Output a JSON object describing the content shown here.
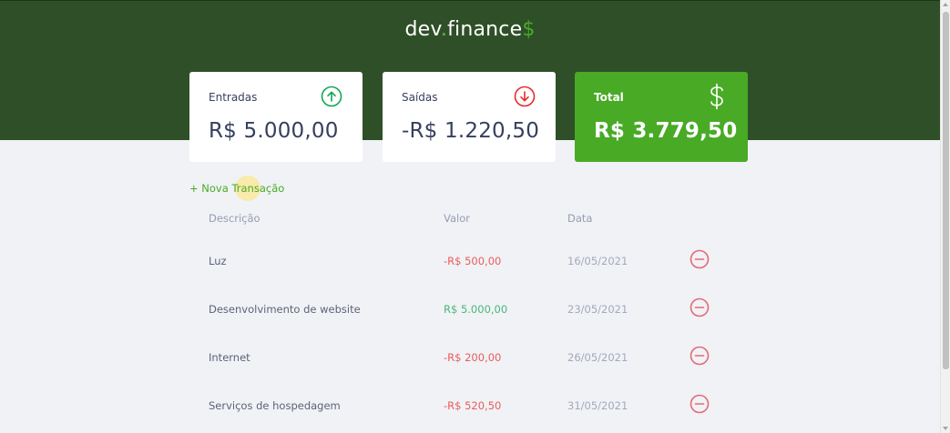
{
  "header": {
    "logo_main": "dev",
    "logo_dot": ".",
    "logo_rest": "finance",
    "logo_symbol": "$"
  },
  "cards": {
    "income": {
      "title": "Entradas",
      "value": "R$ 5.000,00",
      "icon": "arrow-up-circle-icon",
      "color": "#12a454"
    },
    "expense": {
      "title": "Saídas",
      "value": "-R$ 1.220,50",
      "icon": "arrow-down-circle-icon",
      "color": "#e92929"
    },
    "total": {
      "title": "Total",
      "value": "R$ 3.779,50",
      "icon": "dollar-sign-icon",
      "color": "#49aa26"
    }
  },
  "new_transaction": {
    "label": "+ Nova Transação"
  },
  "table": {
    "headers": {
      "description": "Descrição",
      "amount": "Valor",
      "date": "Data"
    },
    "rows": [
      {
        "description": "Luz",
        "amount": "-R$ 500,00",
        "type": "expense",
        "date": "16/05/2021"
      },
      {
        "description": "Desenvolvimento de website",
        "amount": "R$ 5.000,00",
        "type": "income",
        "date": "23/05/2021"
      },
      {
        "description": "Internet",
        "amount": "-R$ 200,00",
        "type": "expense",
        "date": "26/05/2021"
      },
      {
        "description": "Serviços de hospedagem",
        "amount": "-R$ 520,50",
        "type": "expense",
        "date": "31/05/2021"
      }
    ]
  },
  "colors": {
    "header_bg": "#2f4f28",
    "accent_green": "#49aa26",
    "expense_red": "#e92929",
    "income_green": "#12a454",
    "page_bg": "#f0f2f5"
  }
}
